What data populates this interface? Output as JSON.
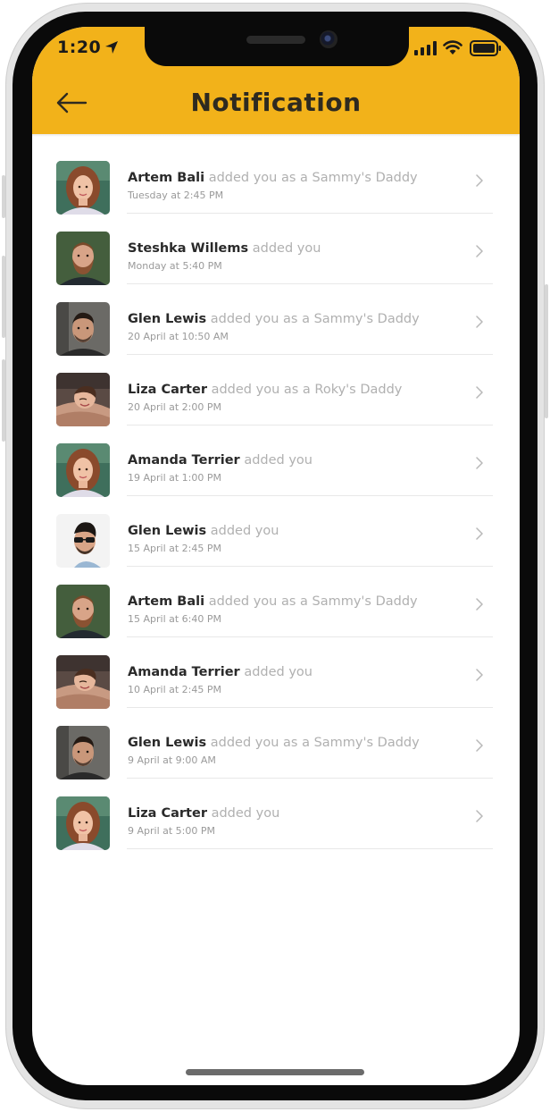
{
  "status_bar": {
    "time": "1:20"
  },
  "header": {
    "title": "Notification",
    "background_color": "#f2b21a"
  },
  "notifications": [
    {
      "name": "Artem Bali",
      "action": "added you as a Sammy's Daddy",
      "time": "Tuesday at 2:45 PM",
      "avatar": "woman-portrait-green"
    },
    {
      "name": "Steshka Willems",
      "action": "added you",
      "time": "Monday at 5:40 PM",
      "avatar": "bearded-man-portrait"
    },
    {
      "name": "Glen Lewis",
      "action": "added you as a Sammy's Daddy",
      "time": "20 April at 10:50 AM",
      "avatar": "man-portrait-dark"
    },
    {
      "name": "Liza Carter",
      "action": "added you as a Roky's Daddy",
      "time": "20 April at 2:00 PM",
      "avatar": "woman-smiling-blanket"
    },
    {
      "name": "Amanda Terrier",
      "action": "added you",
      "time": "19 April at 1:00 PM",
      "avatar": "woman-portrait-green"
    },
    {
      "name": "Glen Lewis",
      "action": "added you",
      "time": "15 April at 2:45 PM",
      "avatar": "man-sunglasses"
    },
    {
      "name": "Artem Bali",
      "action": "added you as a Sammy's Daddy",
      "time": "15 April at 6:40 PM",
      "avatar": "bearded-man-portrait"
    },
    {
      "name": "Amanda Terrier",
      "action": "added you",
      "time": "10 April at 2:45 PM",
      "avatar": "woman-smiling-blanket"
    },
    {
      "name": "Glen Lewis",
      "action": "added you as a Sammy's Daddy",
      "time": "9 April at 9:00 AM",
      "avatar": "man-portrait-dark"
    },
    {
      "name": "Liza Carter",
      "action": "added you",
      "time": "9 April at 5:00 PM",
      "avatar": "woman-portrait-green"
    }
  ]
}
